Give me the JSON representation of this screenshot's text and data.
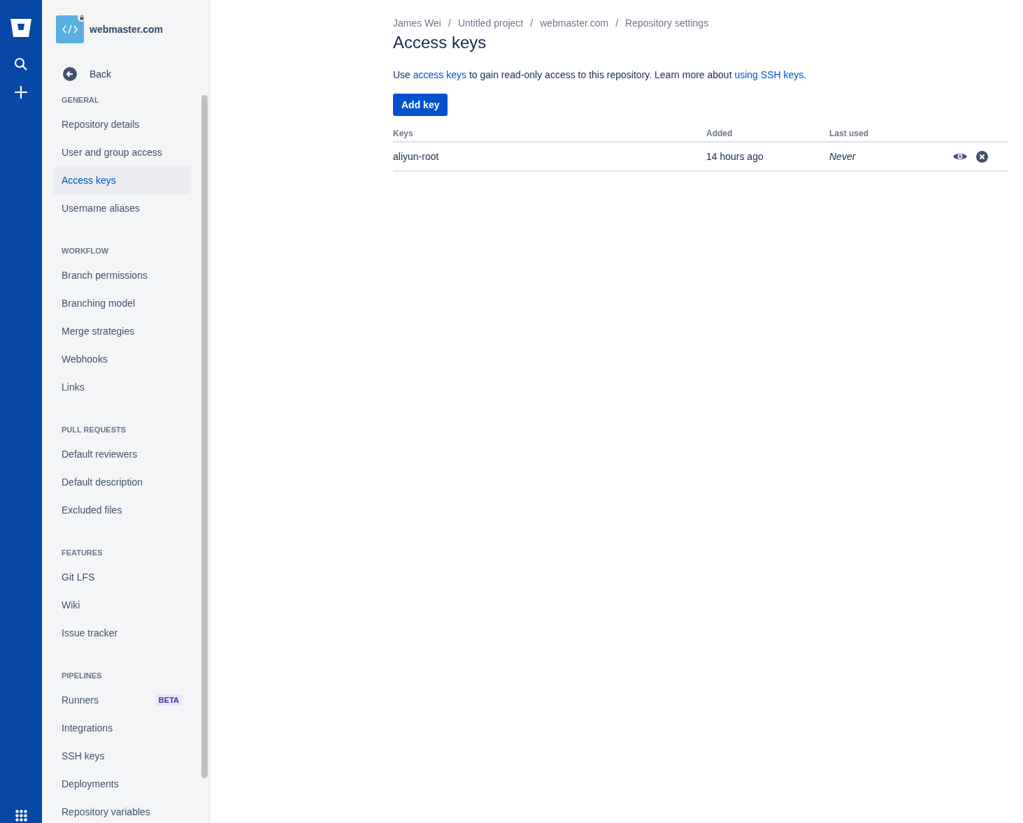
{
  "repository": {
    "name": "webmaster.com",
    "private": true
  },
  "back": {
    "label": "Back"
  },
  "sidebar": {
    "groups": [
      {
        "heading": "GENERAL",
        "items": [
          {
            "label": "Repository details",
            "selected": false
          },
          {
            "label": "User and group access",
            "selected": false
          },
          {
            "label": "Access keys",
            "selected": true
          },
          {
            "label": "Username aliases",
            "selected": false
          }
        ]
      },
      {
        "heading": "WORKFLOW",
        "items": [
          {
            "label": "Branch permissions",
            "selected": false
          },
          {
            "label": "Branching model",
            "selected": false
          },
          {
            "label": "Merge strategies",
            "selected": false
          },
          {
            "label": "Webhooks",
            "selected": false
          },
          {
            "label": "Links",
            "selected": false
          }
        ]
      },
      {
        "heading": "PULL REQUESTS",
        "items": [
          {
            "label": "Default reviewers",
            "selected": false
          },
          {
            "label": "Default description",
            "selected": false
          },
          {
            "label": "Excluded files",
            "selected": false
          }
        ]
      },
      {
        "heading": "FEATURES",
        "items": [
          {
            "label": "Git LFS",
            "selected": false
          },
          {
            "label": "Wiki",
            "selected": false
          },
          {
            "label": "Issue tracker",
            "selected": false
          }
        ]
      },
      {
        "heading": "PIPELINES",
        "items": [
          {
            "label": "Runners",
            "selected": false,
            "badge": "BETA"
          },
          {
            "label": "Integrations",
            "selected": false
          },
          {
            "label": "SSH keys",
            "selected": false
          },
          {
            "label": "Deployments",
            "selected": false
          },
          {
            "label": "Repository variables",
            "selected": false
          }
        ]
      }
    ]
  },
  "breadcrumbs": [
    "James Wei",
    "Untitled project",
    "webmaster.com",
    "Repository settings"
  ],
  "breadcrumb_separators": [
    "/",
    "/",
    "/"
  ],
  "title": "Access keys",
  "description": [
    {
      "kind": "text",
      "text": "Use "
    },
    {
      "kind": "link",
      "text": "access keys"
    },
    {
      "kind": "text",
      "text": " to gain read-only access to this repository. Learn more about "
    },
    {
      "kind": "link",
      "text": "using SSH keys"
    },
    {
      "kind": "text",
      "text": "."
    }
  ],
  "add_button": "Add key",
  "table": {
    "columns": [
      "Keys",
      "Added",
      "Last used"
    ],
    "rows": [
      {
        "key": "aliyun-root",
        "added": "14 hours ago",
        "last_used": "Never"
      }
    ]
  }
}
